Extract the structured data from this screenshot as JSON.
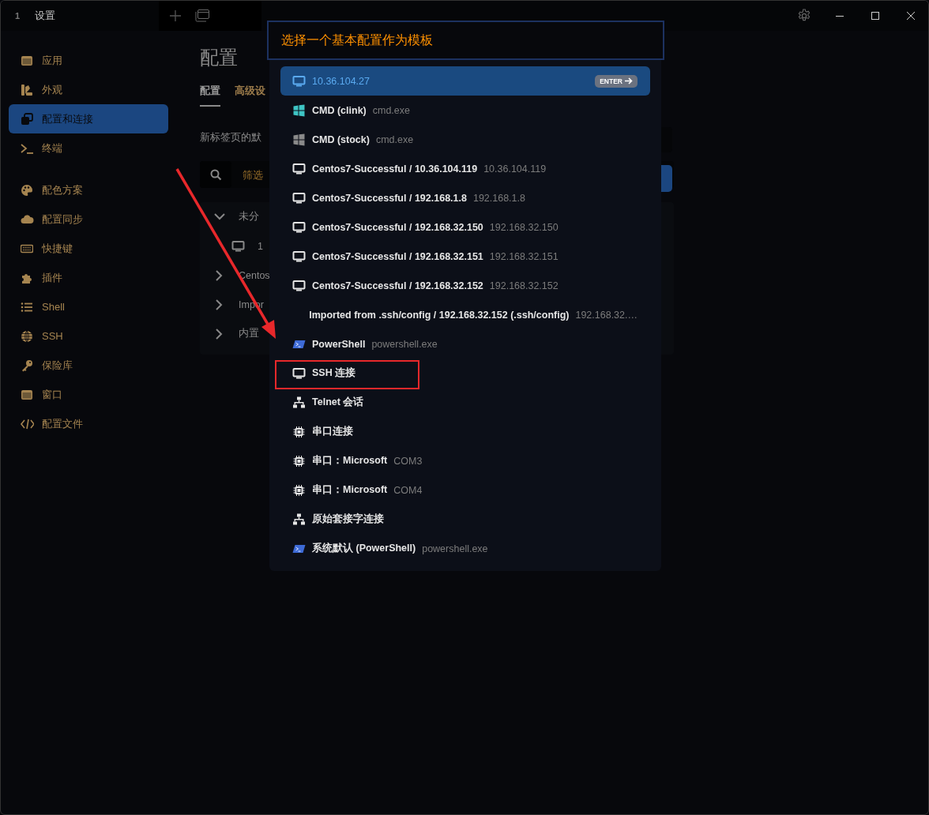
{
  "window": {
    "tab_number": "1",
    "title": "设置"
  },
  "sidebar": {
    "sections": [
      {
        "items": [
          {
            "kind": "app",
            "label": "应用",
            "selected": false
          },
          {
            "kind": "appearance",
            "label": "外观",
            "selected": false
          },
          {
            "kind": "profiles",
            "label": "配置和连接",
            "selected": true
          },
          {
            "kind": "terminal",
            "label": "终端",
            "selected": false
          }
        ]
      },
      {
        "items": [
          {
            "kind": "palette",
            "label": "配色方案",
            "selected": false
          },
          {
            "kind": "cloud",
            "label": "配置同步",
            "selected": false
          },
          {
            "kind": "keyboard",
            "label": "快捷键",
            "selected": false
          },
          {
            "kind": "plugin",
            "label": "插件",
            "selected": false
          },
          {
            "kind": "list",
            "label": "Shell",
            "selected": false
          },
          {
            "kind": "globe",
            "label": "SSH",
            "selected": false
          },
          {
            "kind": "key",
            "label": "保险库",
            "selected": false
          },
          {
            "kind": "app",
            "label": "窗口",
            "selected": false
          },
          {
            "kind": "code",
            "label": "配置文件",
            "selected": false
          }
        ]
      }
    ]
  },
  "main": {
    "title": "配置",
    "tabs": [
      {
        "label": "配置",
        "selected": true
      },
      {
        "label": "高级设",
        "selected": false
      }
    ],
    "description": "新标签页的默",
    "filter": {
      "placeholder": "筛选"
    },
    "tree": [
      {
        "label": "未分",
        "expanded": true,
        "children": [
          {
            "kind": "monitor",
            "label": "1"
          }
        ]
      },
      {
        "label": "Centos",
        "expanded": false
      },
      {
        "label": "Impor",
        "expanded": false
      },
      {
        "label": "内置",
        "expanded": false
      }
    ]
  },
  "picker": {
    "placeholder": "选择一个基本配置作为模板",
    "items": [
      {
        "kind": "monitor",
        "label": "10.36.104.27",
        "selected": true,
        "highlighted": false,
        "hint": "ENTER"
      },
      {
        "kind": "tiles",
        "color": "#3ec4c4",
        "label": "CMD (clink)",
        "detail": "cmd.exe",
        "selected": false,
        "highlighted": false
      },
      {
        "kind": "tiles",
        "color": "#8a8a8a",
        "label": "CMD (stock)",
        "detail": "cmd.exe",
        "selected": false,
        "highlighted": false
      },
      {
        "kind": "monitor",
        "label": "Centos7-Successful / 10.36.104.119",
        "detail": "10.36.104.119",
        "selected": false,
        "highlighted": false
      },
      {
        "kind": "monitor",
        "label": "Centos7-Successful / 192.168.1.8",
        "detail": "192.168.1.8",
        "selected": false,
        "highlighted": false
      },
      {
        "kind": "monitor",
        "label": "Centos7-Successful / 192.168.32.150",
        "detail": "192.168.32.150",
        "selected": false,
        "highlighted": false
      },
      {
        "kind": "monitor",
        "label": "Centos7-Successful / 192.168.32.151",
        "detail": "192.168.32.151",
        "selected": false,
        "highlighted": false
      },
      {
        "kind": "monitor",
        "label": "Centos7-Successful / 192.168.32.152",
        "detail": "192.168.32.152",
        "selected": false,
        "highlighted": false
      },
      {
        "kind": "none",
        "label": "Imported from .ssh/config / 192.168.32.152 (.ssh/config)",
        "detail": "192.168.32.…",
        "selected": false,
        "highlighted": false
      },
      {
        "kind": "prompt",
        "label": "PowerShell",
        "detail": "powershell.exe",
        "selected": false,
        "highlighted": false
      },
      {
        "kind": "monitor",
        "label": "SSH 连接",
        "selected": false,
        "highlighted": true
      },
      {
        "kind": "network",
        "label": "Telnet 会话",
        "selected": false,
        "highlighted": false
      },
      {
        "kind": "chip",
        "label": "串口连接",
        "selected": false,
        "highlighted": false
      },
      {
        "kind": "chip",
        "label": "串口：Microsoft",
        "detail": "COM3",
        "selected": false,
        "highlighted": false
      },
      {
        "kind": "chip",
        "label": "串口：Microsoft",
        "detail": "COM4",
        "selected": false,
        "highlighted": false
      },
      {
        "kind": "network",
        "label": "原始套接字连接",
        "selected": false,
        "highlighted": false
      },
      {
        "kind": "prompt",
        "label": "系统默认 (PowerShell)",
        "detail": "powershell.exe",
        "selected": false,
        "highlighted": false
      }
    ]
  },
  "annotations": {
    "arrow": true
  }
}
